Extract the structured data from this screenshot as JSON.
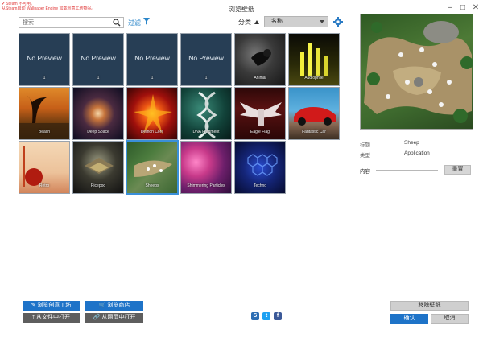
{
  "window": {
    "title": "浏览壁纸",
    "warning_line1": "Steam 不可用。",
    "warning_line2": "从Steam启动 Wallpaper Engine 加载创意工坊物品。"
  },
  "toolbar": {
    "search_placeholder": "搜索",
    "filter_label": "过滤",
    "sort_label": "分类",
    "sort_value": "名称"
  },
  "wallpapers": [
    {
      "title": "No Preview",
      "subtitle": "1",
      "thumb": "none"
    },
    {
      "title": "No Preview",
      "subtitle": "1",
      "thumb": "none"
    },
    {
      "title": "No Preview",
      "subtitle": "1",
      "thumb": "none"
    },
    {
      "title": "No Preview",
      "subtitle": "1",
      "thumb": "none"
    },
    {
      "title": "Animal",
      "thumb": "animal"
    },
    {
      "title": "Audiophile",
      "thumb": "audio"
    },
    {
      "title": "Beach",
      "thumb": "beach"
    },
    {
      "title": "Deep Space",
      "thumb": "deep"
    },
    {
      "title": "Demon Core",
      "thumb": "demon"
    },
    {
      "title": "DNA Fragment",
      "thumb": "dna"
    },
    {
      "title": "Eagle Flag",
      "thumb": "eagle"
    },
    {
      "title": "Fantastic Car",
      "thumb": "car"
    },
    {
      "title": "Retro",
      "thumb": "retro"
    },
    {
      "title": "Ricepod",
      "thumb": "rice"
    },
    {
      "title": "Sheeps",
      "thumb": "sheep",
      "selected": true
    },
    {
      "title": "Shimmering Particles",
      "thumb": "shim"
    },
    {
      "title": "Techno",
      "thumb": "techno"
    }
  ],
  "details": {
    "title_label": "标题",
    "title_value": "Sheep",
    "type_label": "类型",
    "type_value": "Application",
    "content_label": "内容",
    "reset_label": "重置"
  },
  "bottom": {
    "workshop_label": "浏览创意工坊",
    "store_label": "浏览商店",
    "open_file_label": "从文件中打开",
    "open_web_label": "从网页中打开",
    "remove_label": "移除壁纸",
    "ok_label": "确认",
    "cancel_label": "取消",
    "social": [
      "steam",
      "twitter",
      "facebook"
    ]
  },
  "colors": {
    "accent_blue": "#1e73c8",
    "tile_empty": "#273e55",
    "warning_red": "#e03a3a"
  }
}
